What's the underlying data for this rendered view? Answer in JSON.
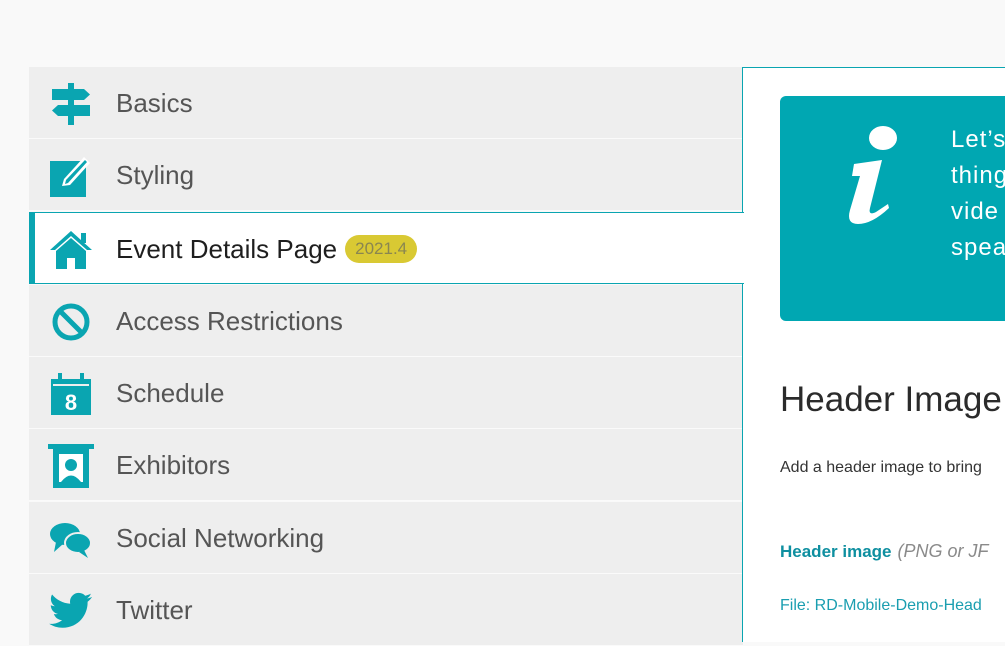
{
  "sidebar": {
    "items": [
      {
        "label": "Basics",
        "icon": "signpost-icon"
      },
      {
        "label": "Styling",
        "icon": "edit-square-icon"
      },
      {
        "label": "Event Details Page",
        "icon": "home-icon",
        "badge": "2021.4",
        "active": true
      },
      {
        "label": "Access Restrictions",
        "icon": "prohibited-icon"
      },
      {
        "label": "Schedule",
        "icon": "calendar-icon"
      },
      {
        "label": "Exhibitors",
        "icon": "exhibitor-booth-icon"
      },
      {
        "label": "Social Networking",
        "icon": "chat-bubbles-icon"
      },
      {
        "label": "Twitter",
        "icon": "twitter-bird-icon"
      }
    ]
  },
  "icon_glyphs": {
    "calendar_day": "8"
  },
  "content": {
    "info": {
      "lines": [
        "Let’s",
        "thing",
        "vide",
        "spea"
      ]
    },
    "section_title": "Header Image",
    "section_description": "Add a header image to bring",
    "header_field": {
      "label": "Header image",
      "hint": "(PNG or JF"
    },
    "file_link": "File: RD-Mobile-Demo-Head"
  },
  "colors": {
    "accent": "#0aa5b1",
    "badge_bg": "#d9c933",
    "sidebar_bg": "#eeeeee",
    "info_bg": "#00a7b2"
  }
}
